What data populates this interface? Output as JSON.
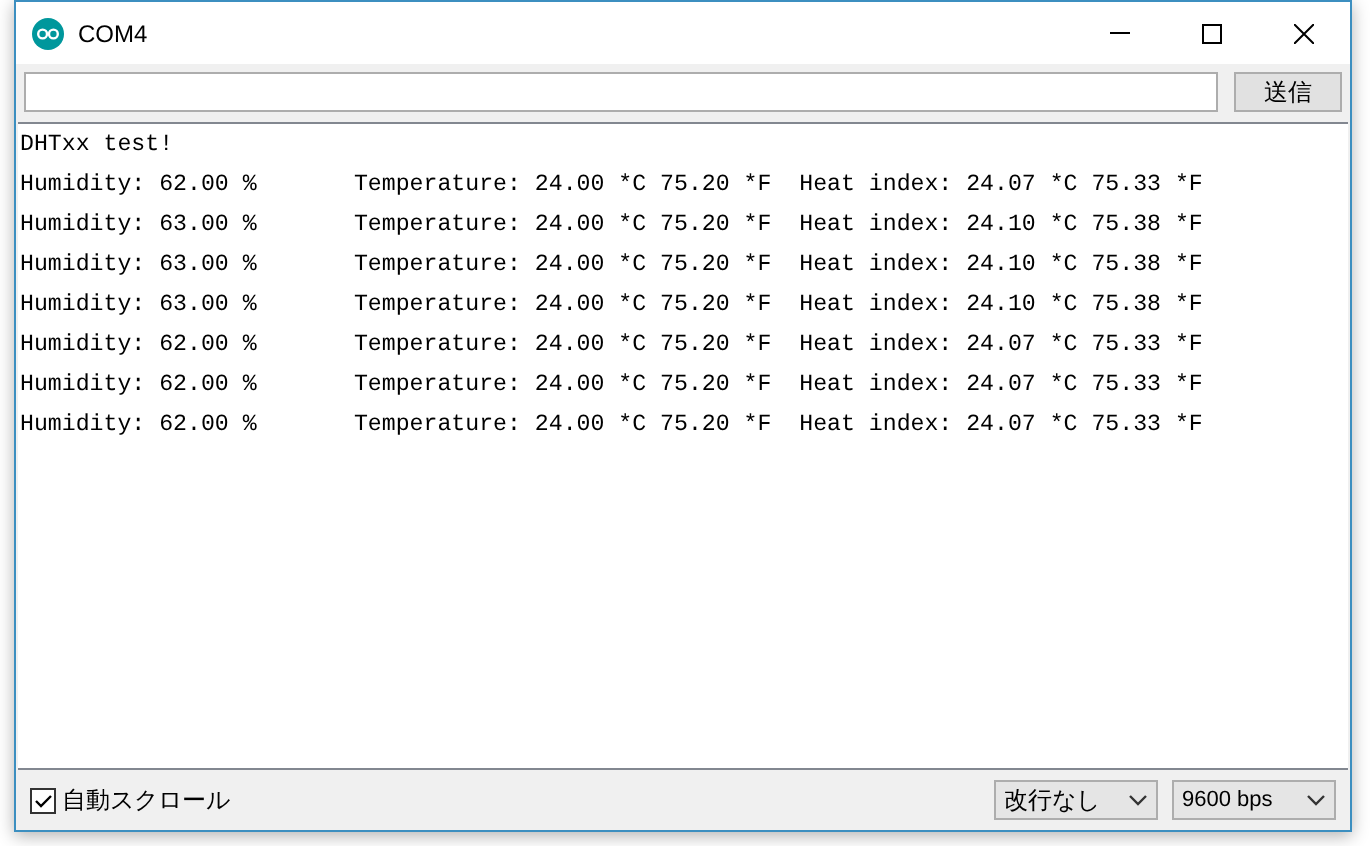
{
  "window": {
    "title": "COM4"
  },
  "send_button": "送信",
  "output_lines": [
    "DHTxx test!",
    "Humidity: 62.00 %       Temperature: 24.00 *C 75.20 *F  Heat index: 24.07 *C 75.33 *F",
    "Humidity: 63.00 %       Temperature: 24.00 *C 75.20 *F  Heat index: 24.10 *C 75.38 *F",
    "Humidity: 63.00 %       Temperature: 24.00 *C 75.20 *F  Heat index: 24.10 *C 75.38 *F",
    "Humidity: 63.00 %       Temperature: 24.00 *C 75.20 *F  Heat index: 24.10 *C 75.38 *F",
    "Humidity: 62.00 %       Temperature: 24.00 *C 75.20 *F  Heat index: 24.07 *C 75.33 *F",
    "Humidity: 62.00 %       Temperature: 24.00 *C 75.20 *F  Heat index: 24.07 *C 75.33 *F",
    "Humidity: 62.00 %       Temperature: 24.00 *C 75.20 *F  Heat index: 24.07 *C 75.33 *F"
  ],
  "autoscroll": {
    "label": "自動スクロール",
    "checked": true
  },
  "line_ending": {
    "value": "改行なし"
  },
  "baud_rate": {
    "value": "9600 bps"
  }
}
